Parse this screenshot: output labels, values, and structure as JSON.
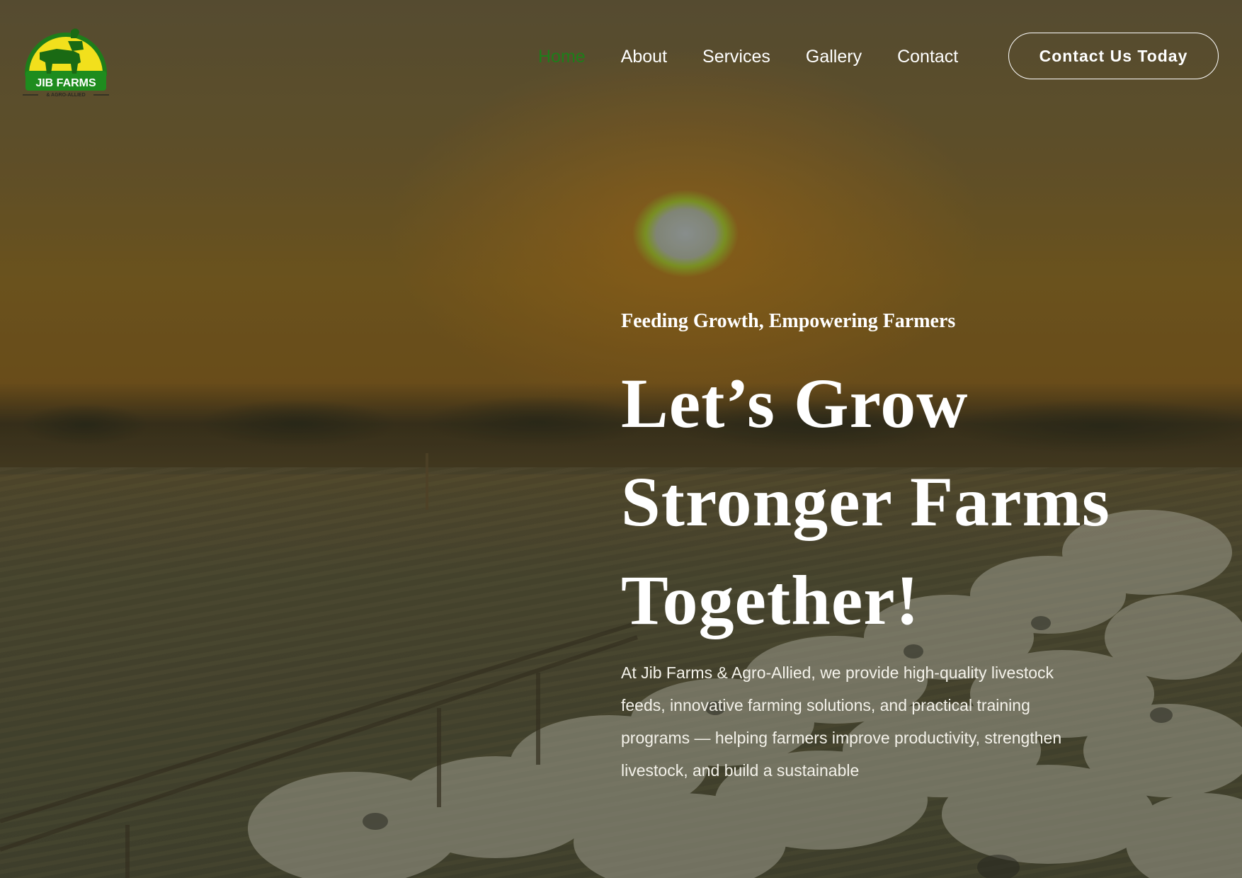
{
  "brand": {
    "logo_title": "JIB FARMS",
    "logo_subtitle": "& AGRO-ALLIED"
  },
  "nav": {
    "items": [
      {
        "label": "Home",
        "active": true
      },
      {
        "label": "About",
        "active": false
      },
      {
        "label": "Services",
        "active": false
      },
      {
        "label": "Gallery",
        "active": false
      },
      {
        "label": "Contact",
        "active": false
      }
    ],
    "cta_label": "Contact Us Today"
  },
  "hero": {
    "tagline": "Feeding Growth, Empowering Farmers",
    "headline_lines": [
      "Let’s Grow",
      "Stronger Farms",
      "Together!"
    ],
    "description_lines": [
      "At Jib Farms & Agro-Allied, we provide high-quality livestock",
      "feeds, innovative farming solutions, and practical training",
      "programs — helping farmers improve productivity, strengthen",
      "livestock, and build a sustainable"
    ]
  },
  "colors": {
    "accent_green": "#1e7d1a",
    "logo_yellow": "#f2e01c",
    "text_white": "#ffffff"
  }
}
